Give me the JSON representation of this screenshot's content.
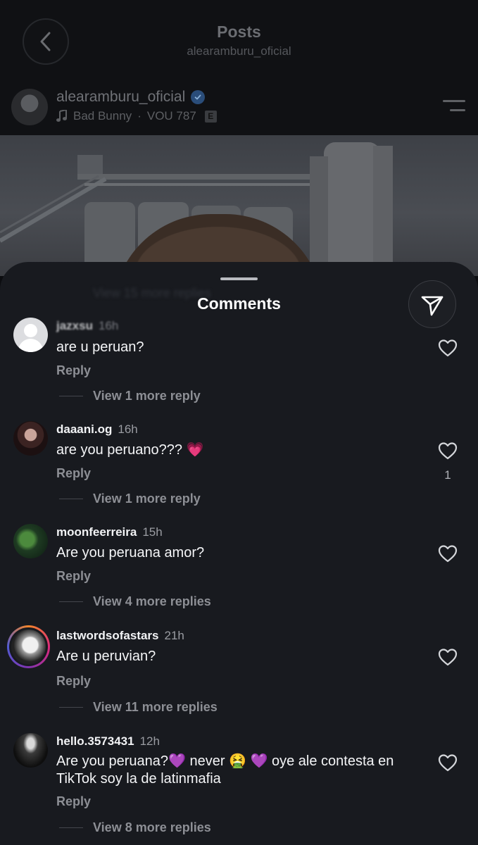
{
  "header": {
    "title": "Posts",
    "subtitle": "alearamburu_oficial"
  },
  "post": {
    "username": "alearamburu_oficial",
    "verified": true,
    "music_artist": "Bad Bunny",
    "music_separator": "·",
    "music_title": "VOU 787",
    "explicit_badge": "E"
  },
  "sheet": {
    "title": "Comments",
    "hidden_text": "View 15 more replies"
  },
  "comments": [
    {
      "username": "jazxsu",
      "time": "16h",
      "text": "are u peruan?",
      "reply_label": "Reply",
      "more_replies": "View 1 more reply",
      "likes": ""
    },
    {
      "username": "daaani.og",
      "time": "16h",
      "text": "are you peruano??? 💗",
      "reply_label": "Reply",
      "more_replies": "View 1 more reply",
      "likes": "1"
    },
    {
      "username": "moonfeerreira",
      "time": "15h",
      "text": "Are you peruana amor?",
      "reply_label": "Reply",
      "more_replies": "View 4 more replies",
      "likes": ""
    },
    {
      "username": "lastwordsofastars",
      "time": "21h",
      "text": "Are u peruvian?",
      "reply_label": "Reply",
      "more_replies": "View 11 more replies",
      "likes": ""
    },
    {
      "username": "hello.3573431",
      "time": "12h",
      "text": "Are you peruana?💜 never 🤮 💜 oye ale contesta en TikTok soy la de latinmafia",
      "reply_label": "Reply",
      "more_replies": "View 8 more replies",
      "likes": ""
    }
  ],
  "colors": {
    "sheet_bg": "#181a1f",
    "text_primary": "#f2f3f5",
    "text_secondary": "#8d8f95",
    "verified_blue": "#2a4d7a"
  },
  "icons": {
    "back": "chevron-left-icon",
    "verified": "verified-check-icon",
    "music": "music-note-icon",
    "menu": "menu-lines-icon",
    "share": "paper-plane-icon",
    "like": "heart-outline-icon"
  }
}
